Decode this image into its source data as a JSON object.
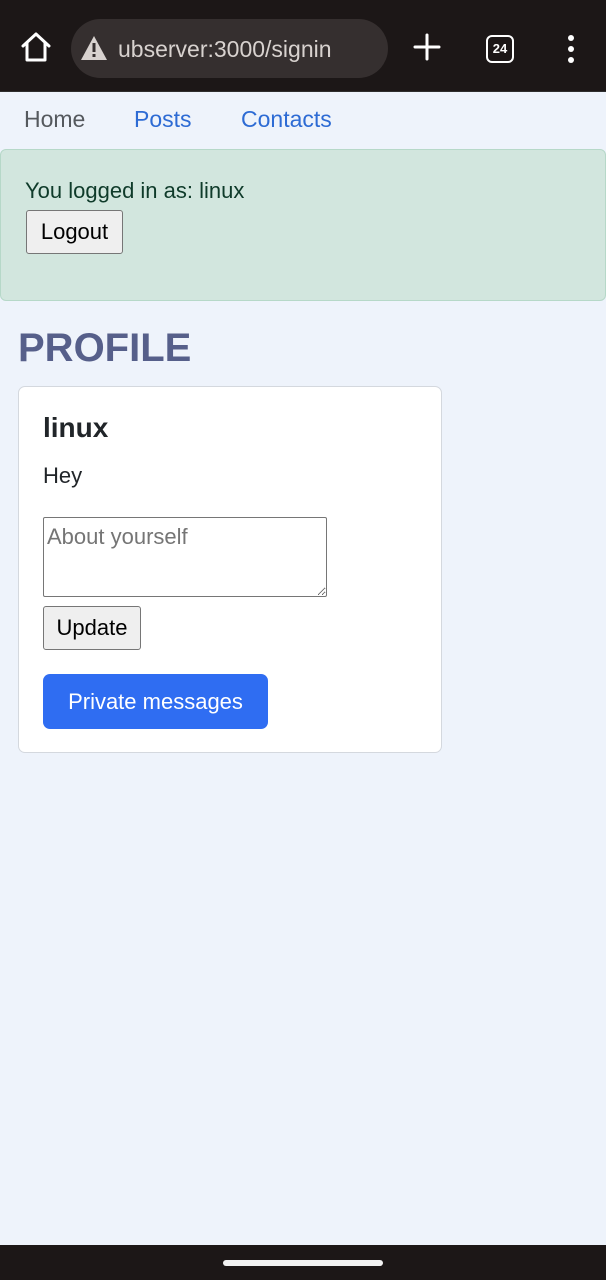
{
  "browser": {
    "url": "ubserver:3000/signin",
    "tab_count": "24"
  },
  "nav": {
    "home": "Home",
    "posts": "Posts",
    "contacts": "Contacts"
  },
  "alert": {
    "message": "You logged in as: linux",
    "logout_label": "Logout"
  },
  "profile": {
    "title": "PROFILE",
    "username": "linux",
    "bio": "Hey",
    "about_placeholder": "About yourself",
    "about_value": "",
    "update_label": "Update",
    "private_messages_label": "Private messages"
  },
  "colors": {
    "browser_chrome": "#1c1717",
    "page_background": "#eef3fb",
    "link": "#2d6bd4",
    "alert_background": "#d2e6de",
    "title": "#565f8a",
    "primary_button": "#2f6df2"
  },
  "icons": {
    "home": "home-icon",
    "warning": "warning-icon",
    "new_tab": "plus-icon",
    "menu": "more-vertical-icon"
  }
}
